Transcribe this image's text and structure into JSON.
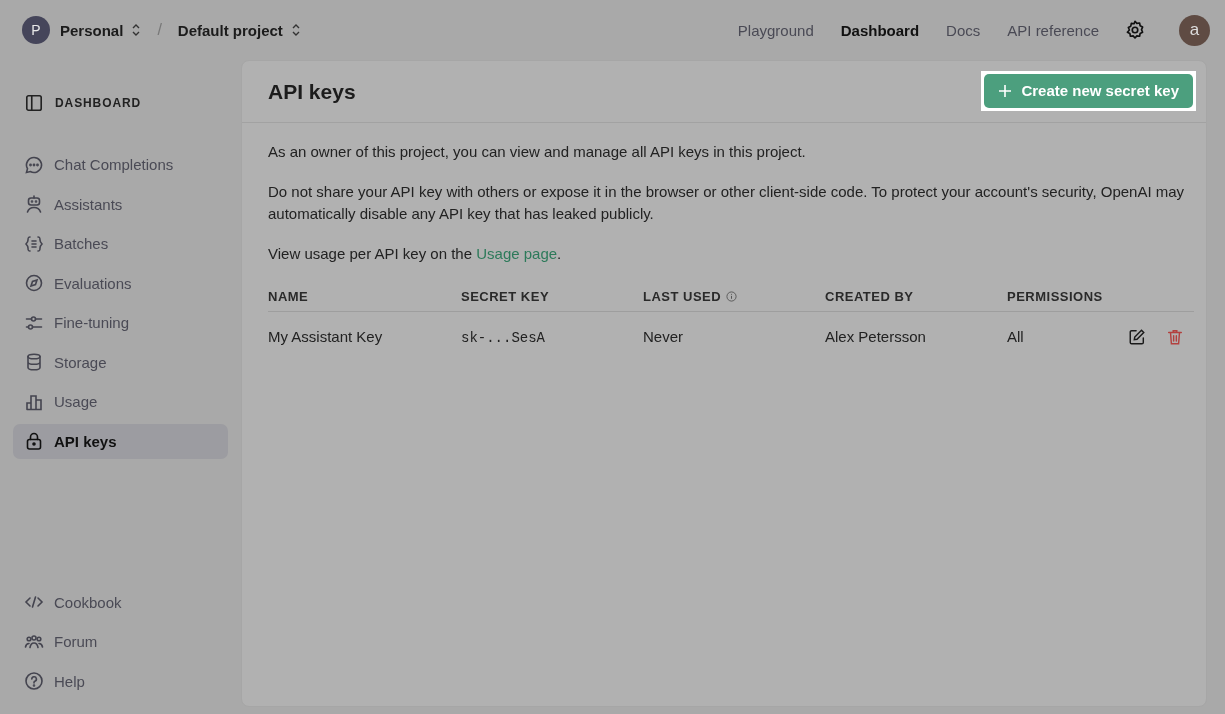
{
  "topbar": {
    "org_initial": "P",
    "org": "Personal",
    "separator": "/",
    "project": "Default project",
    "nav": [
      {
        "label": "Playground",
        "selected": false
      },
      {
        "label": "Dashboard",
        "selected": true
      },
      {
        "label": "Docs",
        "selected": false
      },
      {
        "label": "API reference",
        "selected": false
      }
    ],
    "avatar": "a"
  },
  "sidebar": {
    "heading": "DASHBOARD",
    "items": [
      {
        "label": "Chat Completions",
        "selected": false
      },
      {
        "label": "Assistants",
        "selected": false
      },
      {
        "label": "Batches",
        "selected": false
      },
      {
        "label": "Evaluations",
        "selected": false
      },
      {
        "label": "Fine-tuning",
        "selected": false
      },
      {
        "label": "Storage",
        "selected": false
      },
      {
        "label": "Usage",
        "selected": false
      },
      {
        "label": "API keys",
        "selected": true
      }
    ],
    "footer_items": [
      {
        "label": "Cookbook"
      },
      {
        "label": "Forum"
      },
      {
        "label": "Help"
      }
    ]
  },
  "main": {
    "title": "API keys",
    "create_button": "Create new secret key",
    "paragraphs": [
      "As an owner of this project, you can view and manage all API keys in this project.",
      "Do not share your API key with others or expose it in the browser or other client-side code. To protect your account's security, OpenAI may automatically disable any API key that has leaked publicly."
    ],
    "usage_note": {
      "before": "View usage per API key on the ",
      "link": "Usage page",
      "after": "."
    },
    "table": {
      "columns": [
        "NAME",
        "SECRET KEY",
        "LAST USED",
        "CREATED BY",
        "PERMISSIONS"
      ],
      "rows": [
        {
          "name": "My Assistant Key",
          "secret_key": "sk-...SesA",
          "last_used": "Never",
          "created_by": "Alex Petersson",
          "permissions": "All"
        }
      ]
    }
  }
}
